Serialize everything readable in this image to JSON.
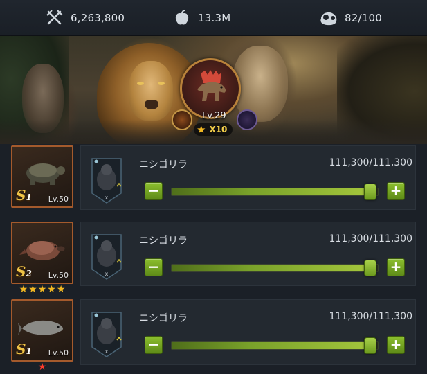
{
  "top_stats": {
    "power": {
      "icon": "crossed-swords-icon",
      "value": "6,263,800"
    },
    "food": {
      "icon": "apple-icon",
      "value": "13.3M"
    },
    "capacity": {
      "icon": "capacity-icon",
      "value": "82/100"
    }
  },
  "hero": {
    "level": "Lv.29",
    "multiplier": "X10",
    "portrait_icon": "dinosaur-icon"
  },
  "rows": [
    {
      "beast": {
        "level": "Lv.50",
        "tier": "S",
        "tier_num": "1",
        "creature": "turtle",
        "stars": 0,
        "star_color": ""
      },
      "troop": {
        "name": "ニシゴリラ",
        "count": "111,300/111,300",
        "fill": 0.96
      }
    },
    {
      "beast": {
        "level": "Lv.50",
        "tier": "S",
        "tier_num": "2",
        "creature": "platypus",
        "stars": 5,
        "star_color": "#f2b822"
      },
      "troop": {
        "name": "ニシゴリラ",
        "count": "111,300/111,300",
        "fill": 0.96
      }
    },
    {
      "beast": {
        "level": "Lv.50",
        "tier": "S",
        "tier_num": "1",
        "creature": "fish",
        "stars": 1,
        "star_color": "#ff3b2b"
      },
      "troop": {
        "name": "ニシゴリラ",
        "count": "111,300/111,300",
        "fill": 0.96
      }
    }
  ],
  "buttons": {
    "minus": "−",
    "plus": "+"
  }
}
